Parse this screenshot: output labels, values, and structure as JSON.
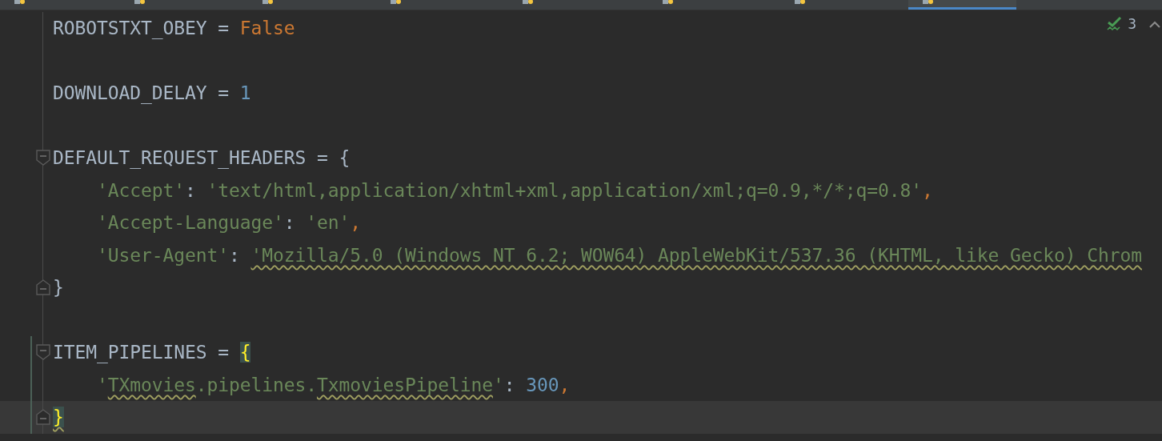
{
  "tabs": [
    {
      "selected": false
    },
    {
      "selected": false
    },
    {
      "selected": false
    },
    {
      "selected": false
    },
    {
      "selected": false
    },
    {
      "selected": false
    },
    {
      "selected": false
    },
    {
      "selected": true
    }
  ],
  "inspection": {
    "count": "3"
  },
  "lines": [
    {
      "kind": "plain",
      "modified": false,
      "current": false,
      "tokens": [
        {
          "kind": "ident",
          "text": "ROBOTSTXT_OBEY"
        },
        {
          "kind": "op",
          "text": " = "
        },
        {
          "kind": "keyword",
          "text": "False"
        }
      ]
    },
    {
      "kind": "plain"
    },
    {
      "kind": "plain",
      "modified": false,
      "current": false,
      "tokens": [
        {
          "kind": "ident",
          "text": "DOWNLOAD_DELAY"
        },
        {
          "kind": "op",
          "text": " = "
        },
        {
          "kind": "number",
          "text": "1"
        }
      ]
    },
    {
      "kind": "plain"
    },
    {
      "kind": "fold-start",
      "modified": false,
      "current": false,
      "tokens": [
        {
          "kind": "ident",
          "text": "DEFAULT_REQUEST_HEADERS"
        },
        {
          "kind": "op",
          "text": " = "
        },
        {
          "kind": "brace",
          "text": "{"
        }
      ]
    },
    {
      "kind": "plain",
      "modified": false,
      "current": false,
      "tokens": [
        {
          "kind": "string",
          "text": "    'Accept'"
        },
        {
          "kind": "op",
          "text": ": "
        },
        {
          "kind": "string",
          "text": "'text/html,application/xhtml+xml,application/xml;q=0.9,*/*;q=0.8'"
        },
        {
          "kind": "punct",
          "text": ","
        }
      ]
    },
    {
      "kind": "plain",
      "modified": false,
      "current": false,
      "tokens": [
        {
          "kind": "string",
          "text": "    'Accept-Language'"
        },
        {
          "kind": "op",
          "text": ": "
        },
        {
          "kind": "string",
          "text": "'en'"
        },
        {
          "kind": "punct",
          "text": ","
        }
      ]
    },
    {
      "kind": "plain",
      "modified": false,
      "current": false,
      "tokens": [
        {
          "kind": "string",
          "text": "    'User-Agent'"
        },
        {
          "kind": "op",
          "text": ": "
        },
        {
          "kind": "string",
          "text": "'Mozilla/5.0 (Windows NT 6.2; WOW64) AppleWebKit/537.36 (KHTML, like Gecko) Chrom",
          "warning": true
        }
      ]
    },
    {
      "kind": "fold-end",
      "modified": false,
      "current": false,
      "tokens": [
        {
          "kind": "brace",
          "text": "}"
        }
      ]
    },
    {
      "kind": "plain"
    },
    {
      "kind": "fold-start",
      "modified": true,
      "current": false,
      "tokens": [
        {
          "kind": "ident",
          "text": "ITEM_PIPELINES"
        },
        {
          "kind": "op",
          "text": " = "
        },
        {
          "kind": "brace",
          "text": "{",
          "matched": true
        }
      ]
    },
    {
      "kind": "plain",
      "modified": true,
      "current": false,
      "tokens": [
        {
          "kind": "string",
          "text": "    '"
        },
        {
          "kind": "string",
          "text": "TXmovies",
          "warning": true
        },
        {
          "kind": "string",
          "text": ".pipelines."
        },
        {
          "kind": "string",
          "text": "TxmoviesPipeline",
          "warning": true
        },
        {
          "kind": "string",
          "text": "'"
        },
        {
          "kind": "op",
          "text": ": "
        },
        {
          "kind": "number",
          "text": "300"
        },
        {
          "kind": "punct",
          "text": ","
        }
      ]
    },
    {
      "kind": "fold-end",
      "modified": true,
      "current": true,
      "tokens": [
        {
          "kind": "brace",
          "text": "}",
          "matched": true,
          "warning": true
        }
      ]
    }
  ]
}
